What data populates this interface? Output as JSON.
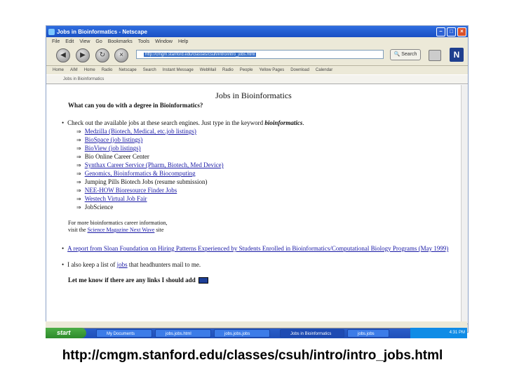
{
  "window": {
    "title": "Jobs in Bioinformatics - Netscape",
    "menu": [
      "File",
      "Edit",
      "View",
      "Go",
      "Bookmarks",
      "Tools",
      "Window",
      "Help"
    ],
    "url": "http://cmgm.stanford.edu/classes/csuh/intro/intro_jobs.html",
    "search_label": "Search",
    "logo_letter": "N",
    "bookmarks": [
      "Home",
      "AIM",
      "Home",
      "Radio",
      "Netscape",
      "Search",
      "Instant Message",
      "WebMail",
      "Radio",
      "People",
      "Yellow Pages",
      "Download",
      "Calendar"
    ],
    "tab_label": "Jobs in Bioinformatics"
  },
  "page": {
    "title": "Jobs in Bioinformatics",
    "question": "What can you do with a degree in Bioinformatics?",
    "intro_text": "Check out the available jobs at these search engines. Just type in the keyword ",
    "intro_keyword": "bioinformatics",
    "intro_end": ".",
    "links": [
      {
        "text": "Medzilla (Biotech, Medical, etc.job listings)",
        "linked": true
      },
      {
        "text": "BioSpace (job listings)",
        "linked": true
      },
      {
        "text": "BioView (job listings)",
        "linked": true
      },
      {
        "text": "Bio Online Career Center",
        "linked": false
      },
      {
        "text": "Synthax Career Service (Pharm, Biotech, Med Device)",
        "linked": true
      },
      {
        "text": "Genomics, Bioinformatics & Biocomputing",
        "linked": true
      },
      {
        "text": "Jumping Pills Biotech Jobs (resume submission)",
        "linked": false
      },
      {
        "text": "NEE-HOW Bioresource Finder Jobs",
        "linked": true
      },
      {
        "text": "Westech Virtual Job Fair",
        "linked": true
      },
      {
        "text": "JobScience",
        "linked": false
      }
    ],
    "career_line1": "For more bioinformatics career information,",
    "career_line2_pre": "visit the ",
    "career_link": "Science Magazine Next Wave",
    "career_line2_post": " site",
    "report_link": "A report from Sloan Foundation on Hiring Patterns Experienced by Students Enrolled in Bioinformatics/Computational Biology Programs (May 1999)",
    "headhunt_pre": "I also keep a list of ",
    "headhunt_link": "jobs",
    "headhunt_post": " that headhunters mail to me.",
    "contact": "Let me know if there are any links I should add"
  },
  "taskbar": {
    "start_label": "start",
    "tasks": [
      "My Documents",
      "jobs.jobs.html",
      "jobs.jobs.jobs",
      "Jobs in Bioinformatics",
      "jobs.jobs"
    ],
    "clock": "4:31 PM"
  },
  "caption": "http://cmgm.stanford.edu/classes/csuh/intro/intro_jobs.html"
}
